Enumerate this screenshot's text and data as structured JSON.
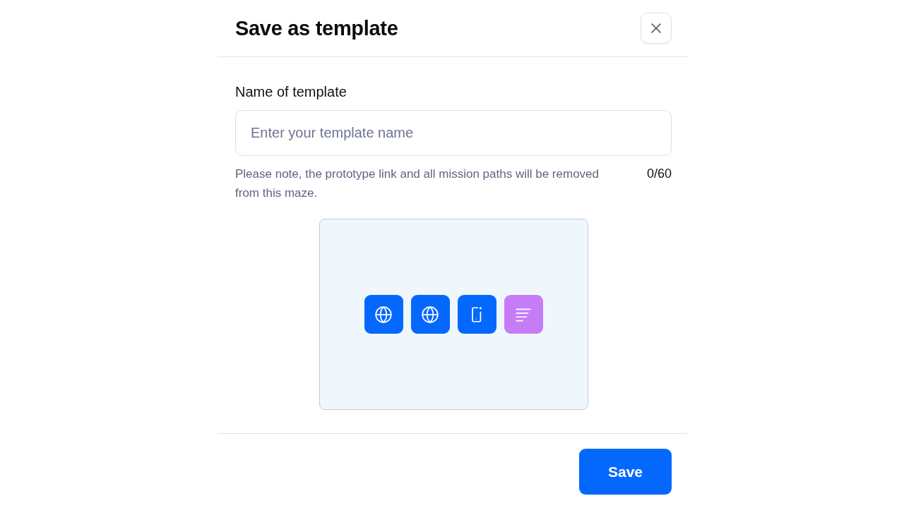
{
  "dialog": {
    "title": "Save as template"
  },
  "field": {
    "label": "Name of template",
    "placeholder": "Enter your template name",
    "counter": "0/60"
  },
  "note": "Please note, the prototype link and all mission paths will be removed from this maze.",
  "preview": {
    "blocks": [
      {
        "kind": "globe",
        "color": "#0568fd"
      },
      {
        "kind": "globe",
        "color": "#0568fd"
      },
      {
        "kind": "phone",
        "color": "#0568fd"
      },
      {
        "kind": "text",
        "color": "#c77cf7"
      }
    ]
  },
  "buttons": {
    "save": "Save"
  }
}
